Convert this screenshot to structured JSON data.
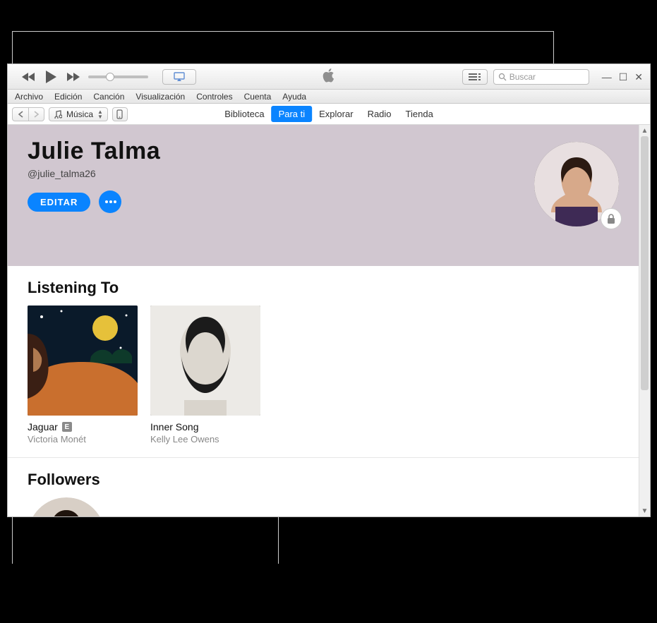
{
  "search_placeholder": "Buscar",
  "menus": {
    "m0": "Archivo",
    "m1": "Edición",
    "m2": "Canción",
    "m3": "Visualización",
    "m4": "Controles",
    "m5": "Cuenta",
    "m6": "Ayuda"
  },
  "library_select_label": "Música",
  "tabs": {
    "t0": "Biblioteca",
    "t1": "Para ti",
    "t2": "Explorar",
    "t3": "Radio",
    "t4": "Tienda"
  },
  "profile": {
    "name": "Julie Talma",
    "handle": "@julie_talma26",
    "edit_label": "EDITAR"
  },
  "sections": {
    "listening_heading": "Listening To",
    "followers_heading": "Followers"
  },
  "albums": {
    "a0": {
      "title": "Jaguar",
      "artist": "Victoria Monét",
      "explicit": "E"
    },
    "a1": {
      "title": "Inner Song",
      "artist": "Kelly Lee Owens"
    }
  }
}
